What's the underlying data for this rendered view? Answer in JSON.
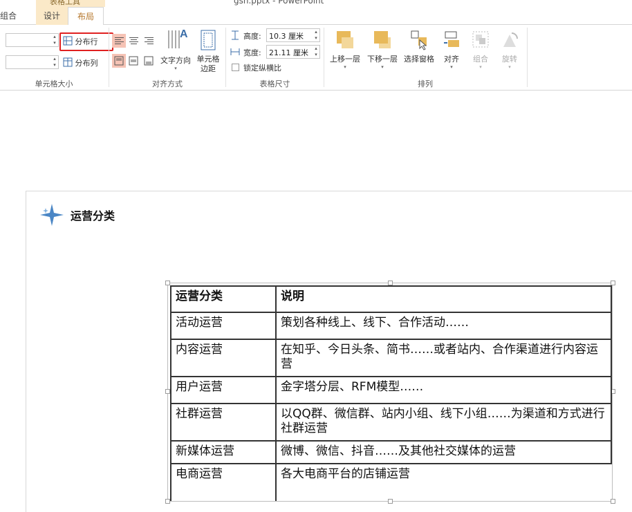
{
  "app": {
    "title": "gsh.pptx - PowerPoint",
    "context_tab_group": "表格工具"
  },
  "tabs": [
    {
      "label": "组合"
    },
    {
      "label": "设计"
    },
    {
      "label": "布局",
      "active": true
    }
  ],
  "ribbon": {
    "cell_size": {
      "label": "单元格大小",
      "height_value": "",
      "width_value": "",
      "distribute_rows": "分布行",
      "distribute_cols": "分布列"
    },
    "alignment": {
      "label": "对齐方式",
      "text_direction": "文字方向",
      "cell_margins_line1": "单元格",
      "cell_margins_line2": "边距"
    },
    "table_size": {
      "label": "表格尺寸",
      "height_label": "高度:",
      "height_value": "10.3 厘米",
      "width_label": "宽度:",
      "width_value": "21.11 厘米",
      "lock_ratio": "锁定纵横比"
    },
    "arrange": {
      "label": "排列",
      "bring_forward": "上移一层",
      "send_backward": "下移一层",
      "selection_pane": "选择窗格",
      "align": "对齐",
      "group": "组合",
      "rotate": "旋转"
    }
  },
  "slide": {
    "title": "运营分类",
    "table": {
      "headers": [
        "运营分类",
        "说明"
      ],
      "rows": [
        [
          "活动运营",
          "策划各种线上、线下、合作活动……"
        ],
        [
          "内容运营",
          "在知乎、今日头条、简书……或者站内、合作渠道进行内容运营"
        ],
        [
          "用户运营",
          "金字塔分层、RFM模型……"
        ],
        [
          "社群运营",
          "以QQ群、微信群、站内小组、线下小组……为渠道和方式进行社群运营"
        ],
        [
          "新媒体运营",
          "微博、微信、抖音……及其他社交媒体的运营"
        ],
        [
          "电商运营",
          "各大电商平台的店铺运营"
        ]
      ]
    }
  },
  "colors": {
    "accent_tab": "#b5762a",
    "context_tab_bg": "#fbe9c8",
    "highlight_box": "#e02020",
    "arrange_icon": "#e8b95a"
  }
}
